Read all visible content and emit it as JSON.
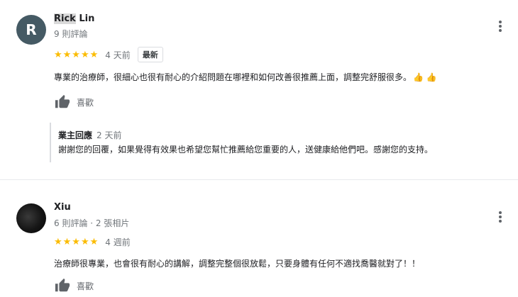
{
  "reviews": [
    {
      "author_highlight": "Rick",
      "author_rest": " Lin",
      "avatar_letter": "R",
      "meta": "9 則評論",
      "stars": "★★★★★",
      "rating": 5,
      "time": "4 天前",
      "badge": "最新",
      "text": "專業的治療師，很細心也很有耐心的介紹問題在哪裡和如何改善很推薦上面，調整完舒服很多。",
      "emoji": "👍 👍",
      "like_label": "喜歡",
      "owner_reply": {
        "label": "業主回應",
        "time": "2 天前",
        "text": "謝謝您的回覆，如果覺得有效果也希望您幫忙推薦給您重要的人，送健康給他們吧。感謝您的支持。"
      }
    },
    {
      "author": "Xiu",
      "meta": "6 則評論 · 2 張相片",
      "stars": "★★★★★",
      "rating": 5,
      "time": "4 週前",
      "text": "治療師很專業，也會很有耐心的講解，調整完整個很放鬆，只要身體有任何不適找喬醫就對了！！",
      "like_label": "喜歡"
    }
  ],
  "colors": {
    "star": "#fbbc04",
    "avatar_r": "#455a64",
    "meta": "#70757a"
  },
  "icons": [
    "thumbs-up-icon",
    "more-vert-icon"
  ]
}
